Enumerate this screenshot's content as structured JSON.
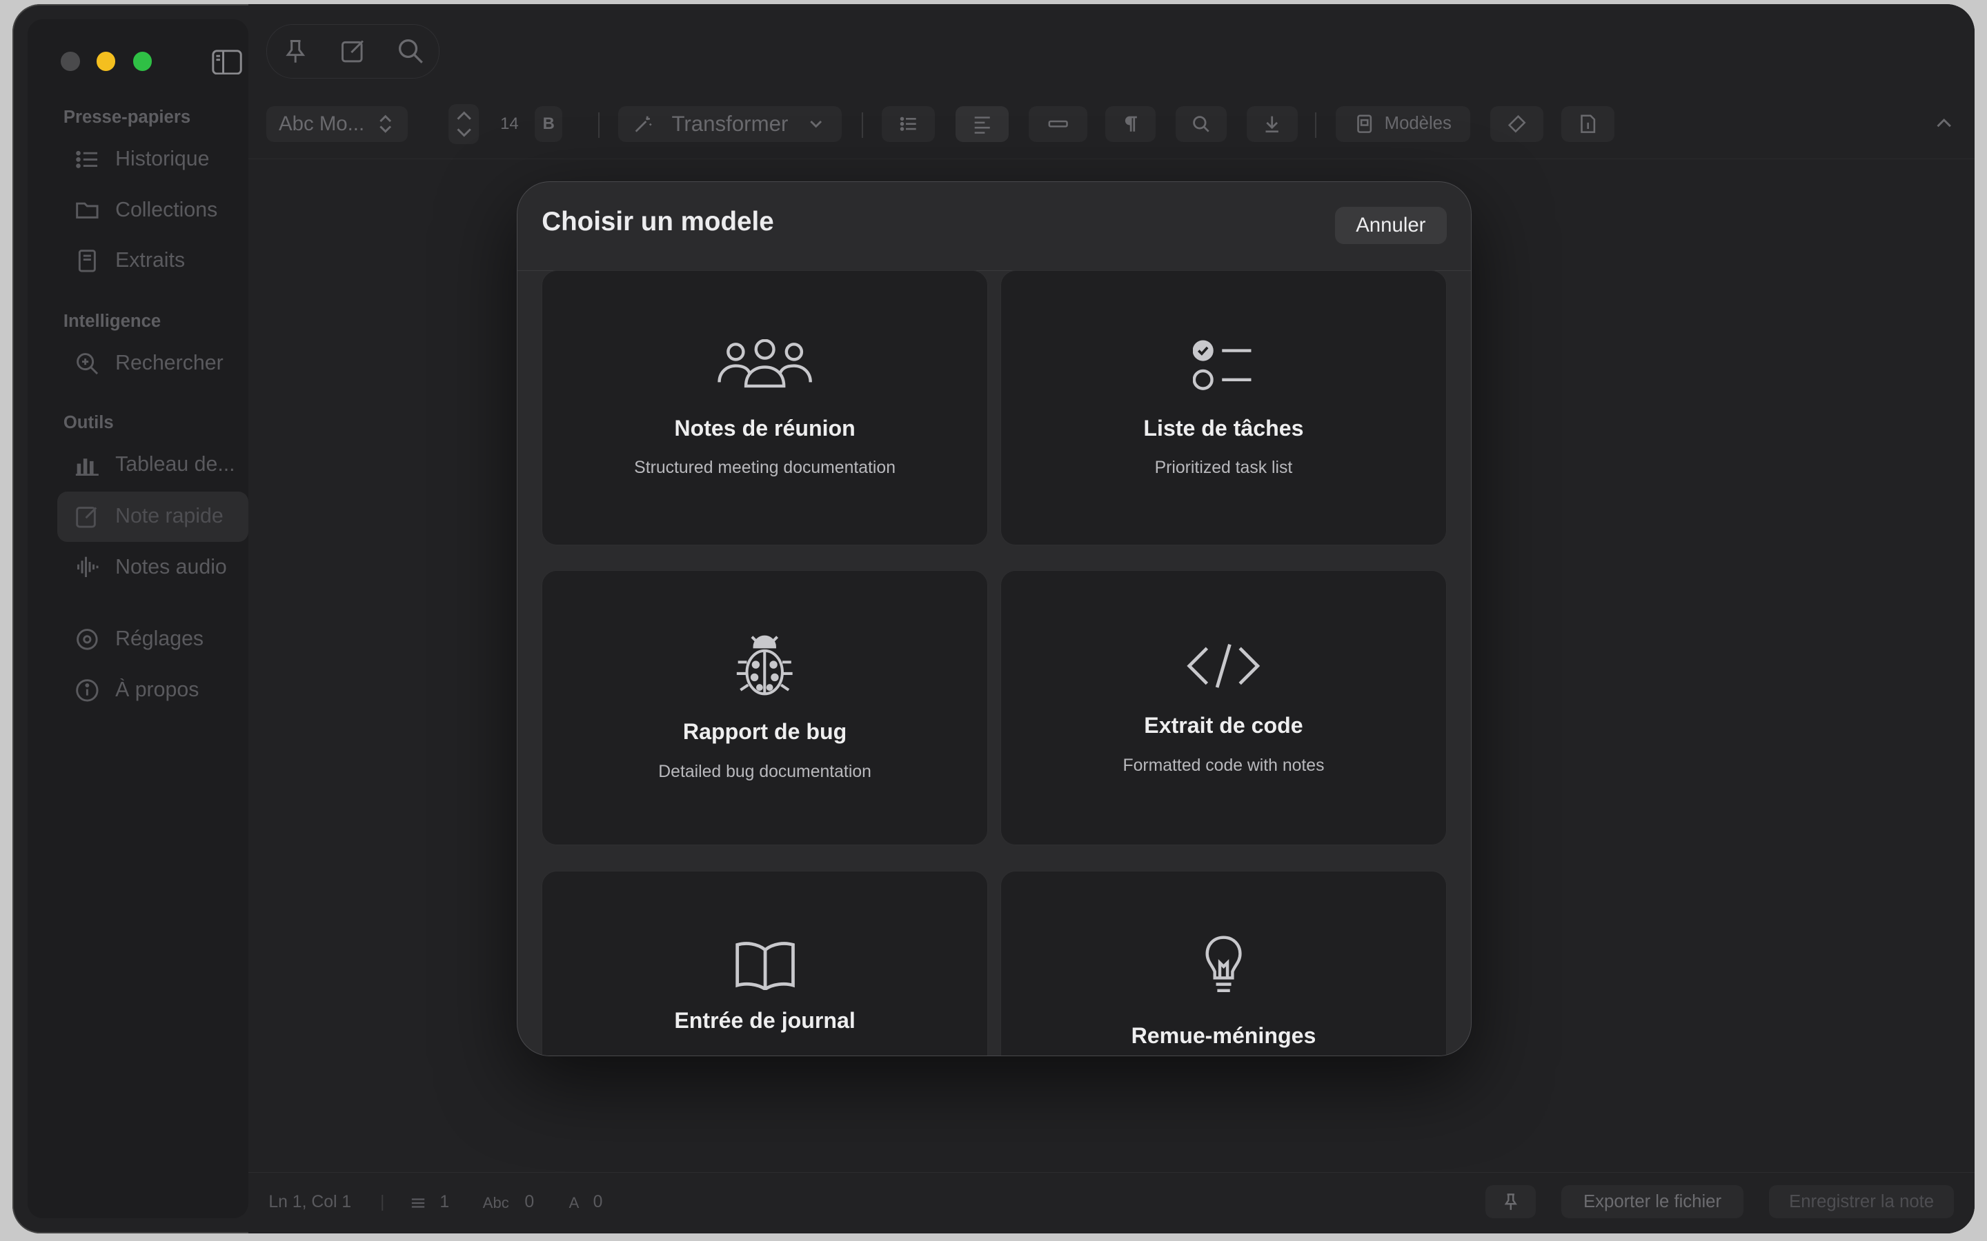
{
  "sidebar": {
    "sections": {
      "clipboard": "Presse-papiers",
      "intelligence": "Intelligence",
      "tools": "Outils"
    },
    "items": [
      {
        "label": "Historique",
        "icon": "list-icon"
      },
      {
        "label": "Collections",
        "icon": "folder-icon"
      },
      {
        "label": "Extraits",
        "icon": "book-icon"
      },
      {
        "label": "Rechercher",
        "icon": "search-sparkle-icon"
      },
      {
        "label": "Tableau de...",
        "icon": "bar-chart-icon"
      },
      {
        "label": "Note rapide",
        "icon": "edit-icon",
        "active": true
      },
      {
        "label": "Notes audio",
        "icon": "waveform-icon"
      },
      {
        "label": "Réglages",
        "icon": "gear-icon"
      },
      {
        "label": "À propos",
        "icon": "info-icon"
      }
    ]
  },
  "toolbar": {
    "font_select": "Abc Mo...",
    "font_size": "14",
    "bold": "B",
    "transform": "Transformer",
    "templates": "Modèles"
  },
  "modal": {
    "title": "Choisir un modele",
    "cancel": "Annuler",
    "templates": [
      {
        "title": "Notes de réunion",
        "desc": "Structured meeting documentation",
        "icon": "people-icon"
      },
      {
        "title": "Liste de tâches",
        "desc": "Prioritized task list",
        "icon": "checklist-icon"
      },
      {
        "title": "Rapport de bug",
        "desc": "Detailed bug documentation",
        "icon": "ladybug-icon"
      },
      {
        "title": "Extrait de code",
        "desc": "Formatted code with notes",
        "icon": "code-icon"
      },
      {
        "title": "Entrée de journal",
        "desc": "",
        "icon": "open-book-icon"
      },
      {
        "title": "Remue-méninges",
        "desc": "",
        "icon": "lightbulb-icon"
      }
    ]
  },
  "status": {
    "position": "Ln 1, Col 1",
    "lines": "1",
    "words_label": "Abc",
    "words": "0",
    "chars_label": "A",
    "chars": "0",
    "export": "Exporter le fichier",
    "save": "Enregistrer la note"
  },
  "colors": {
    "close": "#ec6a5e",
    "minimize": "#f4bf4f",
    "zoom": "#61c554",
    "accent_dark": "#2b2b2d"
  }
}
